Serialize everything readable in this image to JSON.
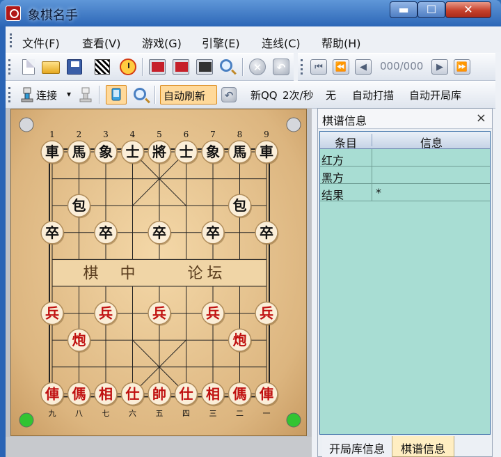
{
  "window": {
    "title": "象棋名手",
    "min_glyph": "▬",
    "max_glyph": "☐",
    "close_glyph": "✕"
  },
  "menu": [
    "文件(F)",
    "查看(V)",
    "游戏(G)",
    "引擎(E)",
    "连线(C)",
    "帮助(H)"
  ],
  "toolbar1": {
    "move_counter": "000/000",
    "icon_glyphs": {
      "stop": "✕",
      "undo": "↶",
      "first": "⏮",
      "prev_fast": "⏪",
      "prev": "◀",
      "next": "▶",
      "last_fast": "⏩"
    }
  },
  "toolbar2": {
    "connect_label": "连接",
    "dropdown_glyph": "▾",
    "auto_refresh": "自动刷新",
    "new_qq": "新QQ",
    "rate": "2次/秒",
    "none": "无",
    "auto_scan": "自动打描",
    "auto_open": "自动开局库"
  },
  "board": {
    "top_numbers": [
      "1",
      "2",
      "3",
      "4",
      "5",
      "6",
      "7",
      "8",
      "9"
    ],
    "bottom_numbers": [
      "九",
      "八",
      "七",
      "六",
      "五",
      "四",
      "三",
      "二",
      "一"
    ],
    "river_left": "棋 中",
    "river_right": "论坛",
    "pieces": [
      {
        "c": "車",
        "col": 0,
        "row": 0,
        "side": "black"
      },
      {
        "c": "馬",
        "col": 1,
        "row": 0,
        "side": "black"
      },
      {
        "c": "象",
        "col": 2,
        "row": 0,
        "side": "black"
      },
      {
        "c": "士",
        "col": 3,
        "row": 0,
        "side": "black"
      },
      {
        "c": "將",
        "col": 4,
        "row": 0,
        "side": "black"
      },
      {
        "c": "士",
        "col": 5,
        "row": 0,
        "side": "black"
      },
      {
        "c": "象",
        "col": 6,
        "row": 0,
        "side": "black"
      },
      {
        "c": "馬",
        "col": 7,
        "row": 0,
        "side": "black"
      },
      {
        "c": "車",
        "col": 8,
        "row": 0,
        "side": "black"
      },
      {
        "c": "包",
        "col": 1,
        "row": 2,
        "side": "black"
      },
      {
        "c": "包",
        "col": 7,
        "row": 2,
        "side": "black"
      },
      {
        "c": "卒",
        "col": 0,
        "row": 3,
        "side": "black"
      },
      {
        "c": "卒",
        "col": 2,
        "row": 3,
        "side": "black"
      },
      {
        "c": "卒",
        "col": 4,
        "row": 3,
        "side": "black"
      },
      {
        "c": "卒",
        "col": 6,
        "row": 3,
        "side": "black"
      },
      {
        "c": "卒",
        "col": 8,
        "row": 3,
        "side": "black"
      },
      {
        "c": "兵",
        "col": 0,
        "row": 6,
        "side": "red"
      },
      {
        "c": "兵",
        "col": 2,
        "row": 6,
        "side": "red"
      },
      {
        "c": "兵",
        "col": 4,
        "row": 6,
        "side": "red"
      },
      {
        "c": "兵",
        "col": 6,
        "row": 6,
        "side": "red"
      },
      {
        "c": "兵",
        "col": 8,
        "row": 6,
        "side": "red"
      },
      {
        "c": "炮",
        "col": 1,
        "row": 7,
        "side": "red"
      },
      {
        "c": "炮",
        "col": 7,
        "row": 7,
        "side": "red"
      },
      {
        "c": "俥",
        "col": 0,
        "row": 9,
        "side": "red"
      },
      {
        "c": "傌",
        "col": 1,
        "row": 9,
        "side": "red"
      },
      {
        "c": "相",
        "col": 2,
        "row": 9,
        "side": "red"
      },
      {
        "c": "仕",
        "col": 3,
        "row": 9,
        "side": "red"
      },
      {
        "c": "帥",
        "col": 4,
        "row": 9,
        "side": "red"
      },
      {
        "c": "仕",
        "col": 5,
        "row": 9,
        "side": "red"
      },
      {
        "c": "相",
        "col": 6,
        "row": 9,
        "side": "red"
      },
      {
        "c": "傌",
        "col": 7,
        "row": 9,
        "side": "red"
      },
      {
        "c": "俥",
        "col": 8,
        "row": 9,
        "side": "red"
      }
    ]
  },
  "panel": {
    "title": "棋谱信息",
    "close": "×",
    "col_item": "条目",
    "col_info": "信息",
    "rows": [
      {
        "k": "红方",
        "v": ""
      },
      {
        "k": "黑方",
        "v": ""
      },
      {
        "k": "结果",
        "v": "*"
      }
    ],
    "tab_opening": "开局库信息",
    "tab_record": "棋谱信息"
  },
  "colors": {
    "red_piece": "#c01010",
    "black_piece": "#111111",
    "board": "#e6c08a",
    "grid_bg": "#a8ddd3"
  }
}
